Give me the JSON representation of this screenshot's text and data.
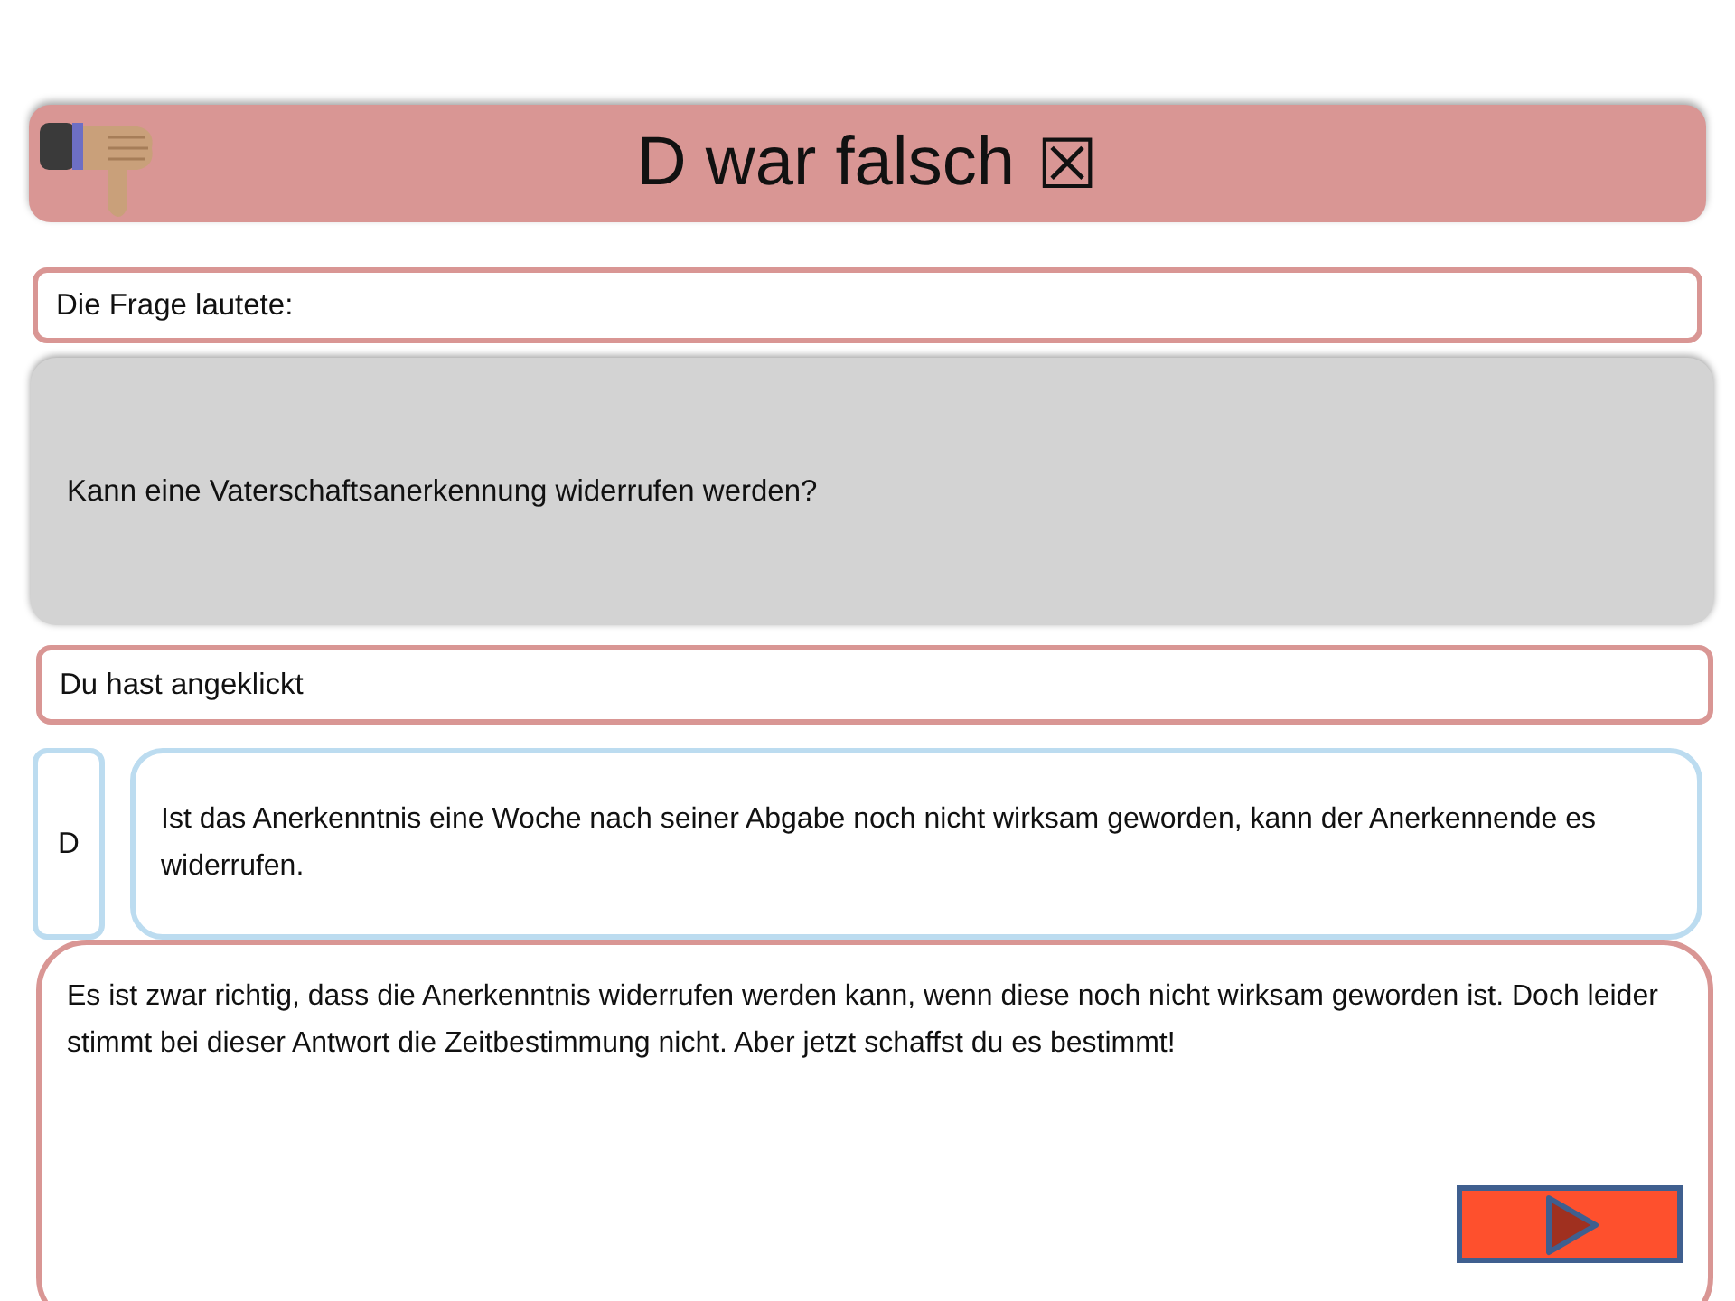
{
  "header": {
    "title": "D war falsch",
    "mark": "☒"
  },
  "question_label": "Die Frage lautete:",
  "question": "Kann eine Vaterschaftsanerkennung widerrufen werden?",
  "clicked_label": "Du hast angeklickt",
  "answer": {
    "letter": "D",
    "text": "Ist das Anerkenntnis eine Woche nach seiner Abgabe noch nicht wirksam geworden, kann der Anerkennende es widerrufen."
  },
  "feedback": "Es ist zwar richtig, dass die Anerkenntnis widerrufen werden kann, wenn diese noch nicht wirksam geworden ist. Doch leider stimmt bei dieser Antwort die Zeitbestimmung nicht. Aber jetzt schaffst du es bestimmt!"
}
